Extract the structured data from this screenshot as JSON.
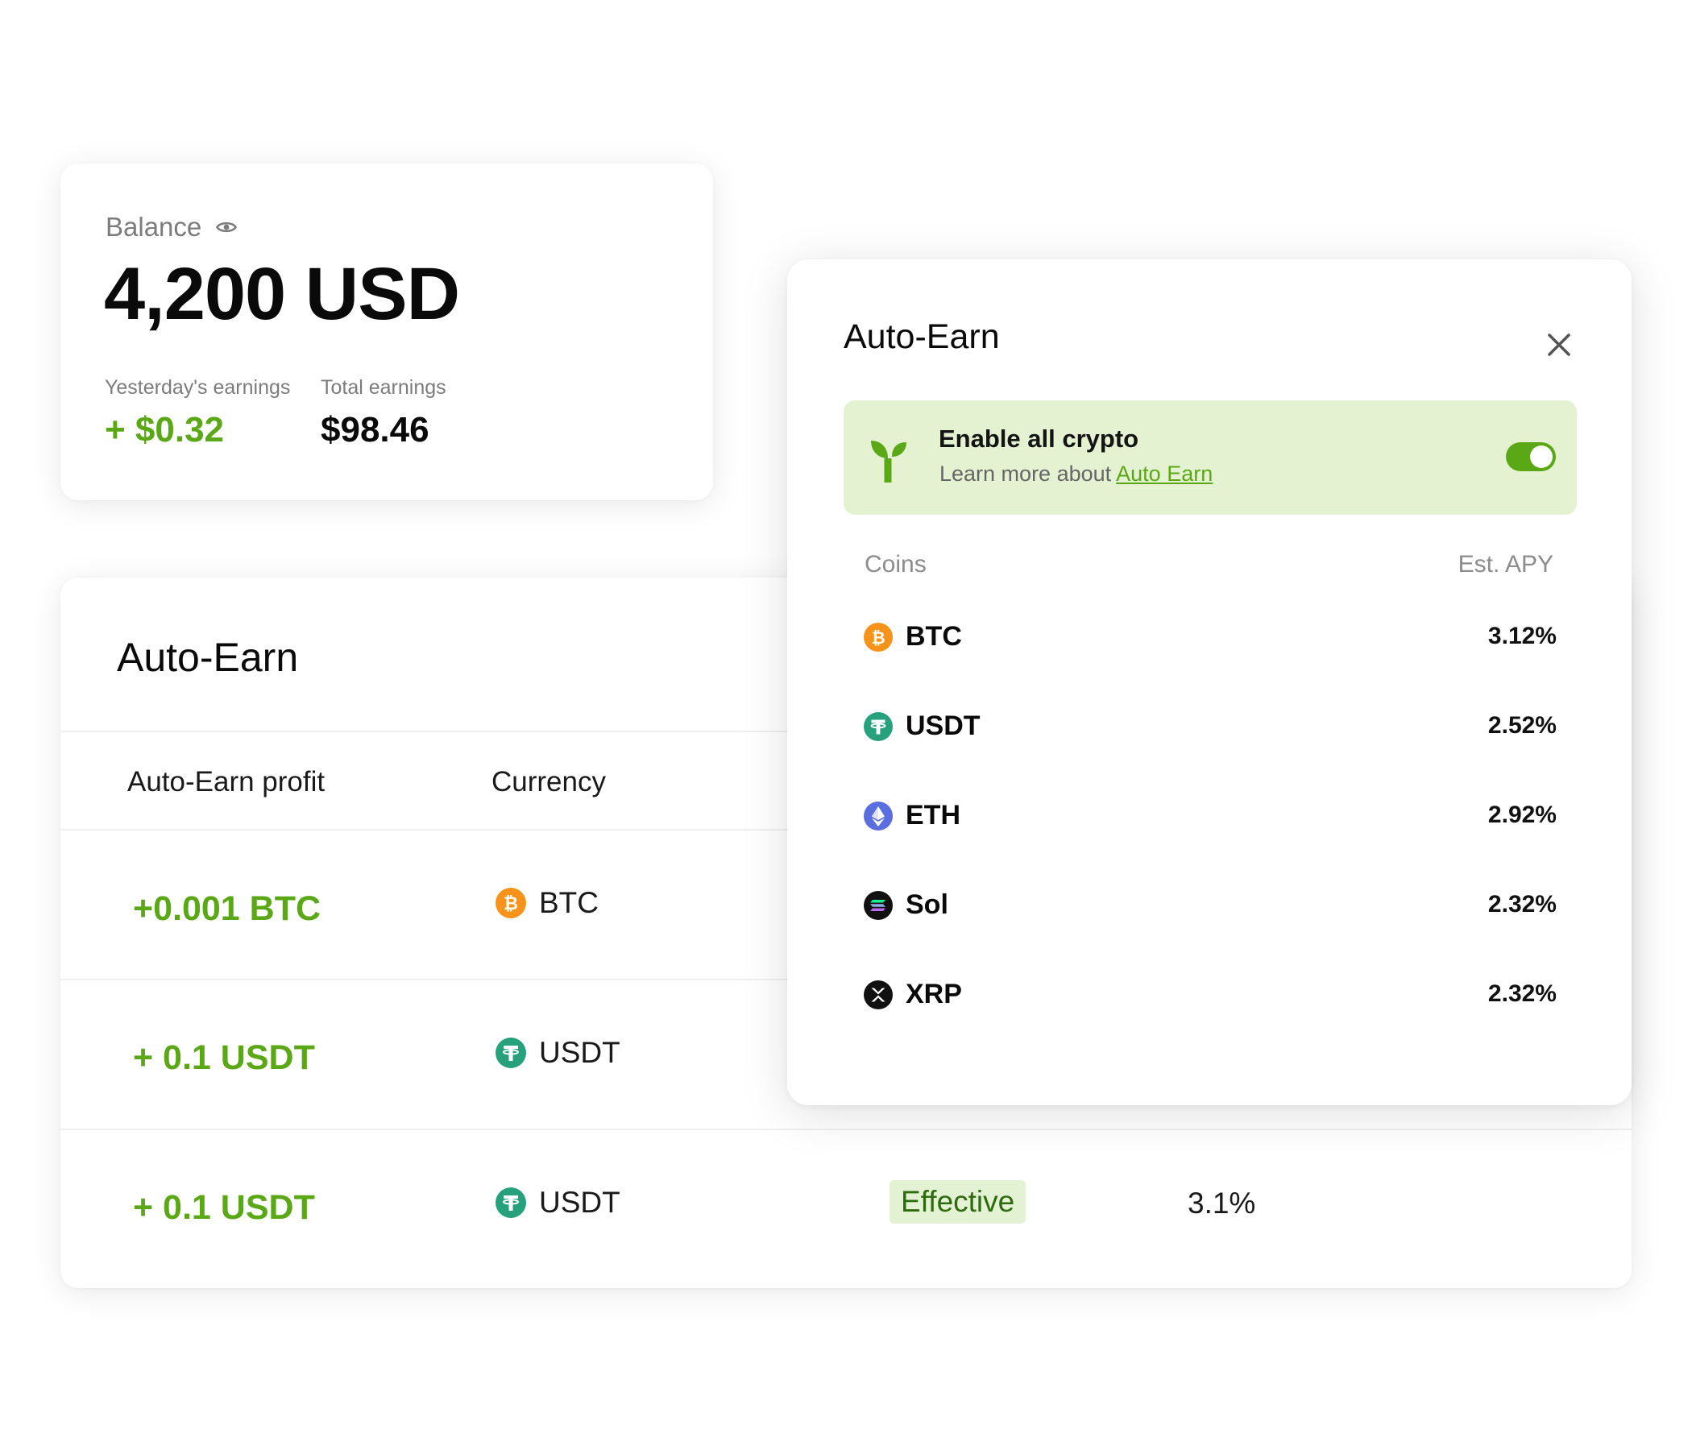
{
  "balance_card": {
    "label": "Balance",
    "amount": "4,200 USD",
    "yesterday_label": "Yesterday's earnings",
    "yesterday_value": "+ $0.32",
    "total_label": "Total earnings",
    "total_value": "$98.46"
  },
  "table_card": {
    "title": "Auto-Earn",
    "headers": {
      "profit": "Auto-Earn profit",
      "currency": "Currency"
    },
    "rows": [
      {
        "profit": "+0.001 BTC",
        "currency": "BTC",
        "icon": "btc-icon"
      },
      {
        "profit": "+ 0.1 USDT",
        "currency": "USDT",
        "icon": "usdt-icon"
      },
      {
        "profit": "+ 0.1 USDT",
        "currency": "USDT",
        "icon": "usdt-icon",
        "status": "Effective",
        "apy": "3.1%"
      }
    ]
  },
  "modal": {
    "title": "Auto-Earn",
    "enable": {
      "title": "Enable all crypto",
      "subtitle": "Learn more about",
      "link": "Auto Earn",
      "enabled": true
    },
    "col_coins": "Coins",
    "col_apy": "Est. APY",
    "coins": [
      {
        "name": "BTC",
        "apy": "3.12%",
        "icon": "btc-icon"
      },
      {
        "name": "USDT",
        "apy": "2.52%",
        "icon": "usdt-icon"
      },
      {
        "name": "ETH",
        "apy": "2.92%",
        "icon": "eth-icon"
      },
      {
        "name": "Sol",
        "apy": "2.32%",
        "icon": "sol-icon"
      },
      {
        "name": "XRP",
        "apy": "2.32%",
        "icon": "xrp-icon"
      }
    ]
  },
  "colors": {
    "accent_green": "#5aa815",
    "enable_bg": "#e4f2d2",
    "btc": "#f7931a",
    "usdt": "#26a17b",
    "eth": "#5a6ee0",
    "sol": "#111111",
    "xrp": "#111111"
  }
}
